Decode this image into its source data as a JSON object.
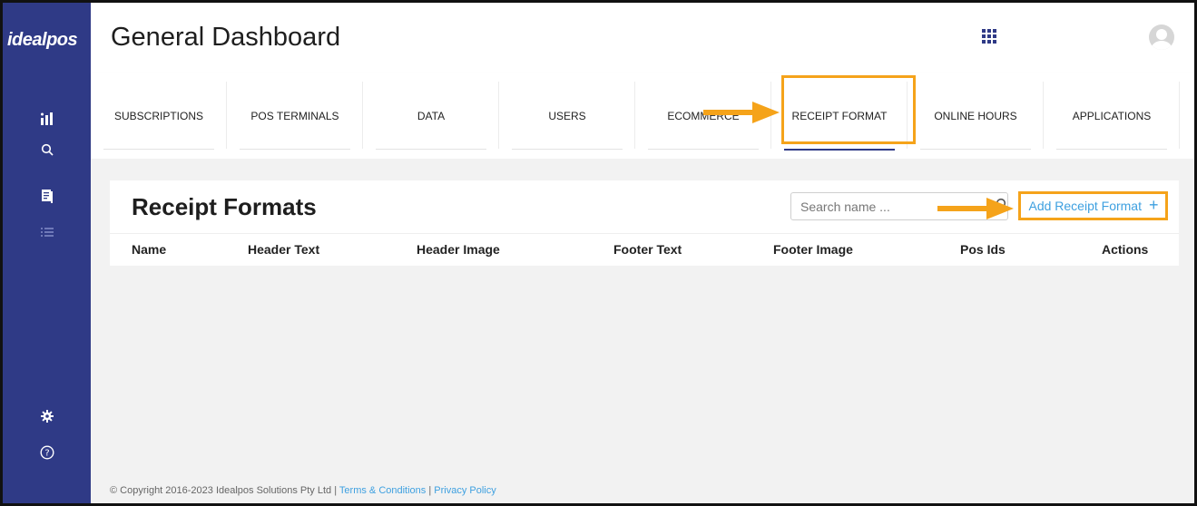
{
  "app": {
    "logo": "idealpos",
    "title": "General Dashboard"
  },
  "sidebar": {
    "icons": [
      "bar-chart-icon",
      "search-icon",
      "document-icon",
      "list-icon",
      "gear-icon",
      "help-circle-icon"
    ]
  },
  "header": {
    "apps_icon": "grid-icon",
    "avatar": "user-avatar"
  },
  "tabs": [
    {
      "label": "SUBSCRIPTIONS"
    },
    {
      "label": "POS TERMINALS"
    },
    {
      "label": "DATA"
    },
    {
      "label": "USERS"
    },
    {
      "label": "ECOMMERCE"
    },
    {
      "label": "RECEIPT FORMAT",
      "active": true
    },
    {
      "label": "ONLINE HOURS"
    },
    {
      "label": "APPLICATIONS"
    }
  ],
  "receipt_formats": {
    "title": "Receipt Formats",
    "search_placeholder": "Search name ...",
    "add_button": "Add Receipt Format",
    "add_icon": "+",
    "columns": [
      "Name",
      "Header Text",
      "Header Image",
      "Footer Text",
      "Footer Image",
      "Pos Ids",
      "Actions"
    ]
  },
  "footer": {
    "copyright": "© Copyright 2016-2023 Idealpos Solutions Pty Ltd | ",
    "terms": "Terms & Conditions",
    "separator": " | ",
    "privacy": "Privacy Policy"
  },
  "colors": {
    "sidebar": "#2f3a86",
    "accent_link": "#3ea0e0",
    "highlight": "#f5a31a",
    "content_bg": "#f2f2f2"
  }
}
